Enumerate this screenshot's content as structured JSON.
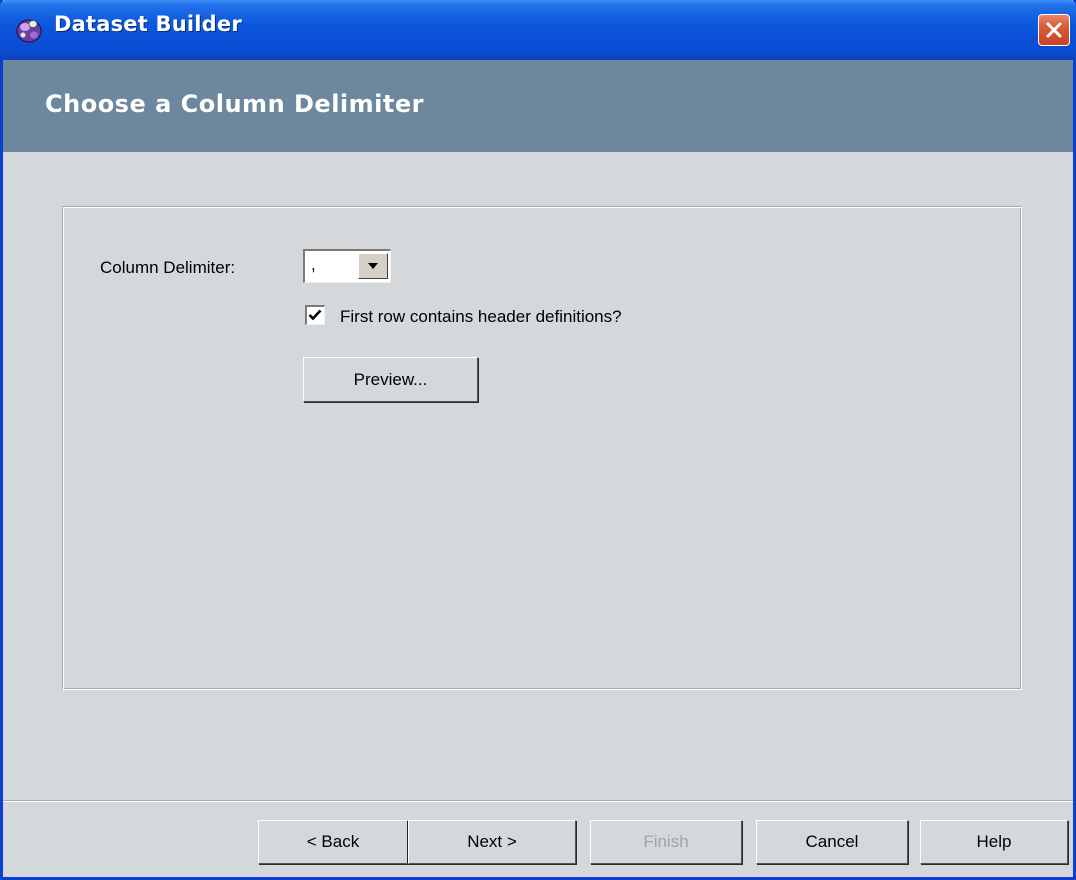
{
  "window": {
    "title": "Dataset Builder",
    "close_icon": "close-icon"
  },
  "header": {
    "title": "Choose a Column Delimiter"
  },
  "form": {
    "delimiter_label": "Column Delimiter:",
    "delimiter_value": ",",
    "header_checkbox_label": "First row contains header definitions?",
    "header_checkbox_checked": true,
    "preview_label": "Preview..."
  },
  "footer": {
    "back_label": "< Back",
    "next_label": "Next >",
    "finish_label": "Finish",
    "finish_enabled": false,
    "cancel_label": "Cancel",
    "help_label": "Help"
  },
  "colors": {
    "titlebar": "#0b58dc",
    "header_band": "#6d889e",
    "dialog_bg": "#d5d8db",
    "close_button": "#d95a36"
  }
}
